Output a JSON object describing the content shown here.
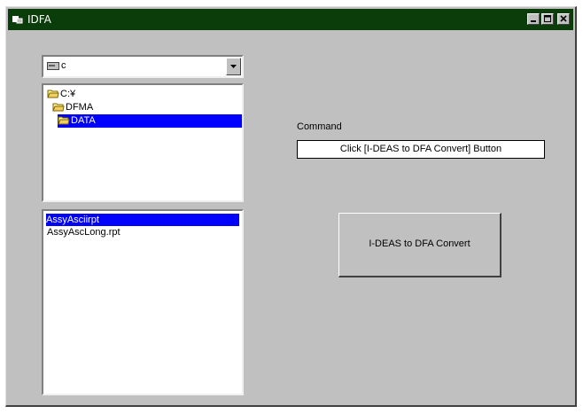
{
  "window": {
    "title": "IDFA",
    "controls": [
      "minimize-icon",
      "maximize-icon",
      "close-icon"
    ]
  },
  "drive_selector": {
    "value": "c"
  },
  "directory_list": {
    "items": [
      {
        "label": "C:¥",
        "selected": false
      },
      {
        "label": "DFMA",
        "selected": false
      },
      {
        "label": "DATA",
        "selected": true
      }
    ]
  },
  "file_list": {
    "items": [
      {
        "label": "AssyAsciirpt",
        "selected": true
      },
      {
        "label": "AssyAscLong.rpt",
        "selected": false
      }
    ]
  },
  "command": {
    "label": "Command",
    "value": "Click [I-DEAS to DFA Convert] Button"
  },
  "convert_button": {
    "label": "I-DEAS to DFA Convert"
  },
  "colors": {
    "titlebar": "#0b3d0b",
    "face": "#c0c0c0",
    "selection": "#0000ff"
  }
}
